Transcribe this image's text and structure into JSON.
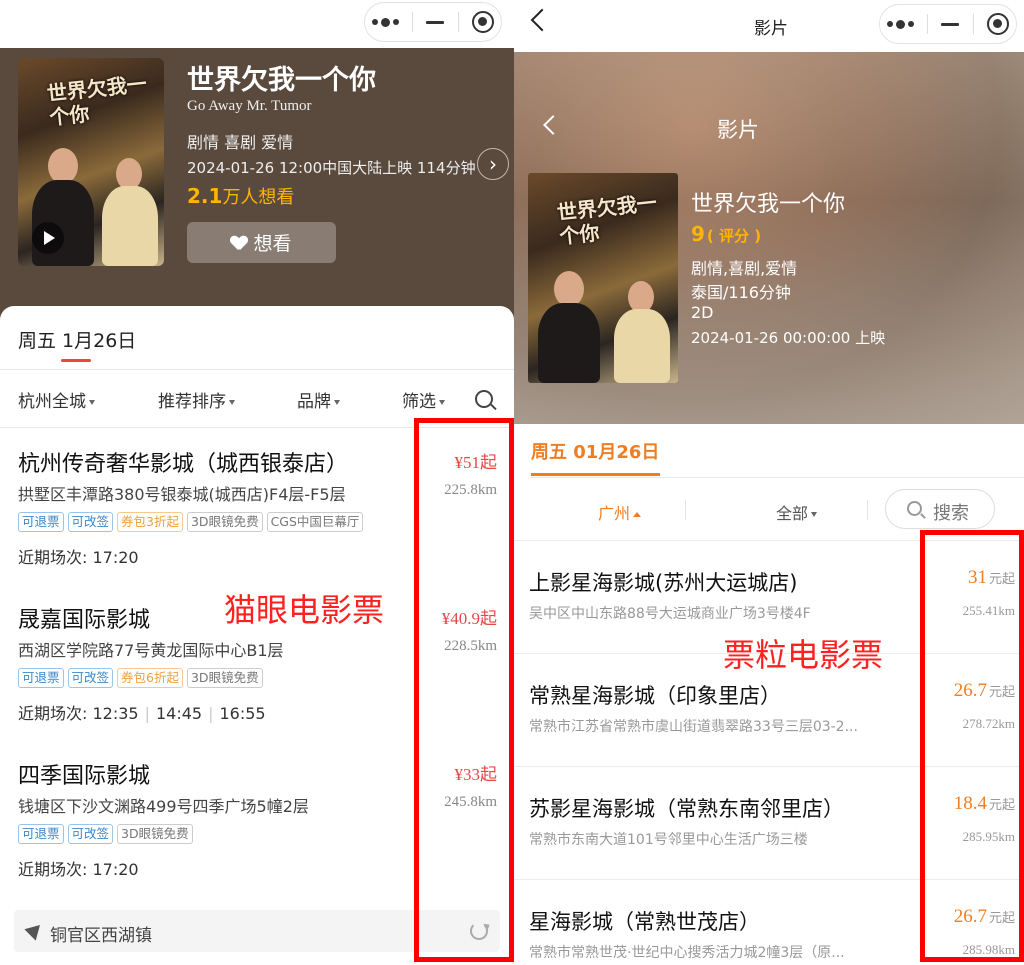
{
  "left": {
    "movie": {
      "title": "世界欠我一个你",
      "english_title": "Go Away Mr. Tumor",
      "genres": "剧情 喜剧 爱情",
      "release": "2024-01-26 12:00中国大陆上映 114分钟",
      "want_count": "2.1",
      "want_suffix": "万人想看",
      "want_button": "想看",
      "poster_text": "世界欠我一个你"
    },
    "date_tab": "周五 1月26日",
    "filters": [
      "杭州全城",
      "推荐排序",
      "品牌",
      "筛选"
    ],
    "cinemas": [
      {
        "name": "杭州传奇奢华影城（城西银泰店）",
        "address": "拱墅区丰潭路380号银泰城(城西店)F4层-F5层",
        "price": "¥51起",
        "distance": "225.8km",
        "tags": [
          {
            "text": "可退票",
            "style": "blue"
          },
          {
            "text": "可改签",
            "style": "blue"
          },
          {
            "text": "券包3折起",
            "style": "orange"
          },
          {
            "text": "3D眼镜免费",
            "style": "gray"
          },
          {
            "text": "CGS中国巨幕厅",
            "style": "gray"
          }
        ],
        "times_label": "近期场次:",
        "times": [
          "17:20"
        ]
      },
      {
        "name": "晟嘉国际影城",
        "address": "西湖区学院路77号黄龙国际中心B1层",
        "price": "¥40.9起",
        "distance": "228.5km",
        "tags": [
          {
            "text": "可退票",
            "style": "blue"
          },
          {
            "text": "可改签",
            "style": "blue"
          },
          {
            "text": "券包6折起",
            "style": "orange"
          },
          {
            "text": "3D眼镜免费",
            "style": "gray"
          }
        ],
        "times_label": "近期场次:",
        "times": [
          "12:35",
          "14:45",
          "16:55"
        ]
      },
      {
        "name": "四季国际影城",
        "address": "钱塘区下沙文渊路499号四季广场5幢2层",
        "price": "¥33起",
        "distance": "245.8km",
        "tags": [
          {
            "text": "可退票",
            "style": "blue"
          },
          {
            "text": "可改签",
            "style": "blue"
          },
          {
            "text": "3D眼镜免费",
            "style": "gray"
          }
        ],
        "times_label": "近期场次:",
        "times": [
          "17:20"
        ]
      }
    ],
    "location": "铜官区西湖镇",
    "annotation": "猫眼电影票"
  },
  "right": {
    "bar_title": "影片",
    "inner_title": "影片",
    "movie": {
      "title": "世界欠我一个你",
      "score": "9",
      "score_label": "( 评分 )",
      "genres": "剧情,喜剧,爱情",
      "country_duration": "泰国/116分钟",
      "format": "2D",
      "release": "2024-01-26 00:00:00 上映",
      "poster_text": "世界欠我一个你"
    },
    "date_tab": "周五 01月26日",
    "city": "广州",
    "all": "全部",
    "search": "搜索",
    "unit": "元起",
    "cinemas": [
      {
        "name": "上影星海影城(苏州大运城店)",
        "address": "吴中区中山东路88号大运城商业广场3号楼4F",
        "price": "31",
        "distance": "255.41km"
      },
      {
        "name": "常熟星海影城（印象里店）",
        "address": "常熟市江苏省常熟市虞山街道翡翠路33号三层03-2...",
        "price": "26.7",
        "distance": "278.72km"
      },
      {
        "name": "苏影星海影城（常熟东南邻里店）",
        "address": "常熟市东南大道101号邻里中心生活广场三楼",
        "price": "18.4",
        "distance": "285.95km"
      },
      {
        "name": "星海影城（常熟世茂店）",
        "address": "常熟市常熟世茂·世纪中心搜秀活力城2幢3层（原...",
        "price": "26.7",
        "distance": "285.98km"
      }
    ],
    "annotation": "票粒电影票"
  }
}
